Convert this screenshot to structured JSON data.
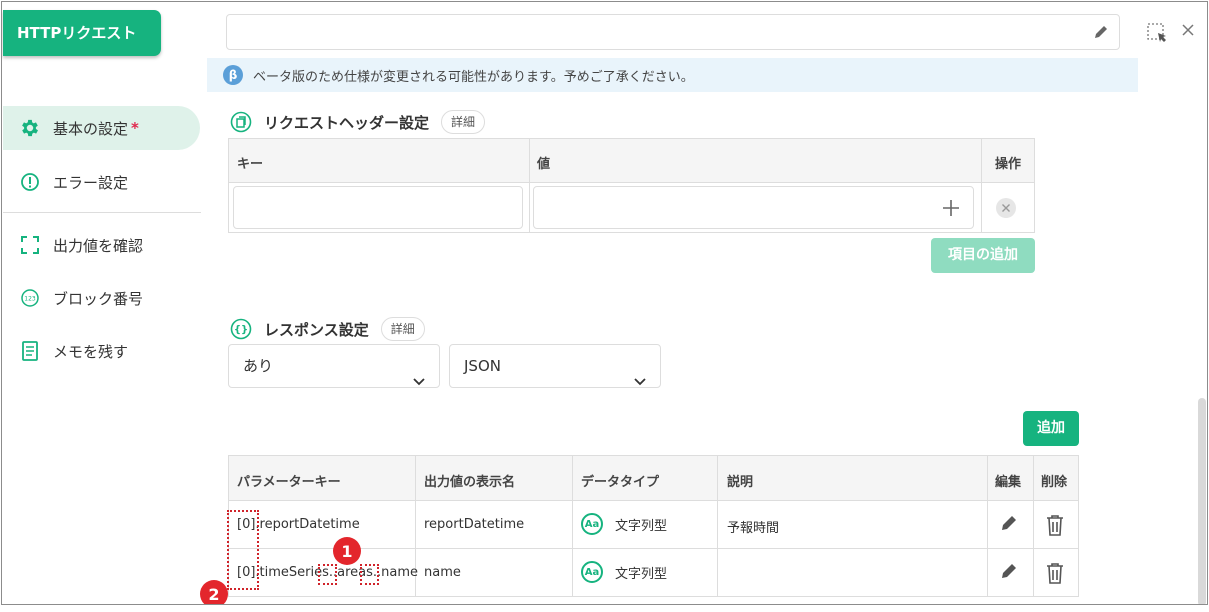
{
  "sidebar": {
    "title": "HTTPリクエスト",
    "items": [
      {
        "label": "基本の設定",
        "required_mark": "*"
      },
      {
        "label": "エラー設定"
      },
      {
        "label": "出力値を確認"
      },
      {
        "label": "ブロック番号"
      },
      {
        "label": "メモを残す"
      }
    ]
  },
  "beta": {
    "badge": "β",
    "message": "ベータ版のため仕様が変更される可能性があります。予めご了承ください。"
  },
  "request_header": {
    "title": "リクエストヘッダー設定",
    "detail_label": "詳細",
    "columns": [
      "キー",
      "値",
      "操作"
    ],
    "add_item_label": "項目の追加"
  },
  "response": {
    "title": "レスポンス設定",
    "detail_label": "詳細",
    "select1_value": "あり",
    "select2_value": "JSON",
    "add_label": "追加"
  },
  "params_table": {
    "columns": [
      "パラメーターキー",
      "出力値の表示名",
      "データタイプ",
      "説明",
      "編集",
      "削除"
    ],
    "rows": [
      {
        "key": "[0].reportDatetime",
        "display_name": "reportDatetime",
        "data_type": "文字列型",
        "description": "予報時間"
      },
      {
        "key": "[0].timeSeries..areas..name",
        "display_name": "name",
        "data_type": "文字列型",
        "description": ""
      }
    ]
  },
  "annotations": {
    "marker1": "1",
    "marker2": "2"
  },
  "colors": {
    "accent": "#16b37f",
    "annotation": "#e3262c",
    "beta": "#5b9fd8"
  }
}
